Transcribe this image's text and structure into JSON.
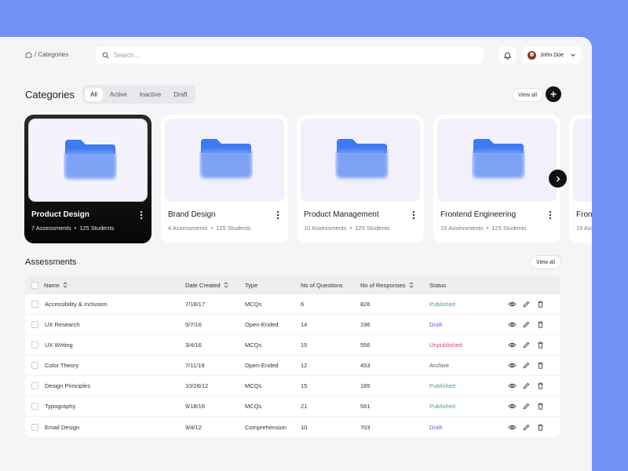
{
  "breadcrumb": {
    "text": "/ Categories"
  },
  "search": {
    "placeholder": "Search..."
  },
  "user": {
    "name": "John Doe"
  },
  "categories": {
    "title": "Categories",
    "filters": [
      "All",
      "Active",
      "Inactive",
      "Draft"
    ],
    "active_filter": "All",
    "view_all": "View all",
    "cards": [
      {
        "name": "Product Design",
        "assessments": "7 Assessments",
        "students": "125 Students",
        "selected": true
      },
      {
        "name": "Brand Design",
        "assessments": "4 Assessments",
        "students": "125 Students"
      },
      {
        "name": "Product Management",
        "assessments": "10 Assessments",
        "students": "125 Students"
      },
      {
        "name": "Frontend Engineering",
        "assessments": "15 Assessments",
        "students": "125 Students"
      },
      {
        "name": "Fron",
        "assessments": "15 Asse",
        "students": ""
      }
    ]
  },
  "assessments": {
    "title": "Assessments",
    "view_all": "View all",
    "columns": [
      "Name",
      "Date Created",
      "Type",
      "No of Questions",
      "No of Responses",
      "Status"
    ],
    "rows": [
      {
        "name": "Accessibility & Inclusion",
        "date": "7/18/17",
        "type": "MCQs",
        "questions": "6",
        "responses": "826",
        "status": "Published"
      },
      {
        "name": "UX Research",
        "date": "5/7/16",
        "type": "Open-Ended",
        "questions": "14",
        "responses": "196",
        "status": "Draft"
      },
      {
        "name": "UX Writing",
        "date": "3/4/16",
        "type": "MCQs",
        "questions": "15",
        "responses": "556",
        "status": "Unpublished"
      },
      {
        "name": "Color Theory",
        "date": "7/11/19",
        "type": "Open-Ended",
        "questions": "12",
        "responses": "453",
        "status": "Archive"
      },
      {
        "name": "Design Principles",
        "date": "10/28/12",
        "type": "MCQs",
        "questions": "15",
        "responses": "185",
        "status": "Published"
      },
      {
        "name": "Typography",
        "date": "9/18/16",
        "type": "MCQs",
        "questions": "21",
        "responses": "561",
        "status": "Published"
      },
      {
        "name": "Email Design",
        "date": "9/4/12",
        "type": "Comprehension",
        "questions": "10",
        "responses": "703",
        "status": "Draft"
      }
    ]
  },
  "colors": {
    "background": "#7390f7",
    "published": "#4fa17a",
    "draft": "#5466e0",
    "unpublished": "#d44c6f"
  }
}
